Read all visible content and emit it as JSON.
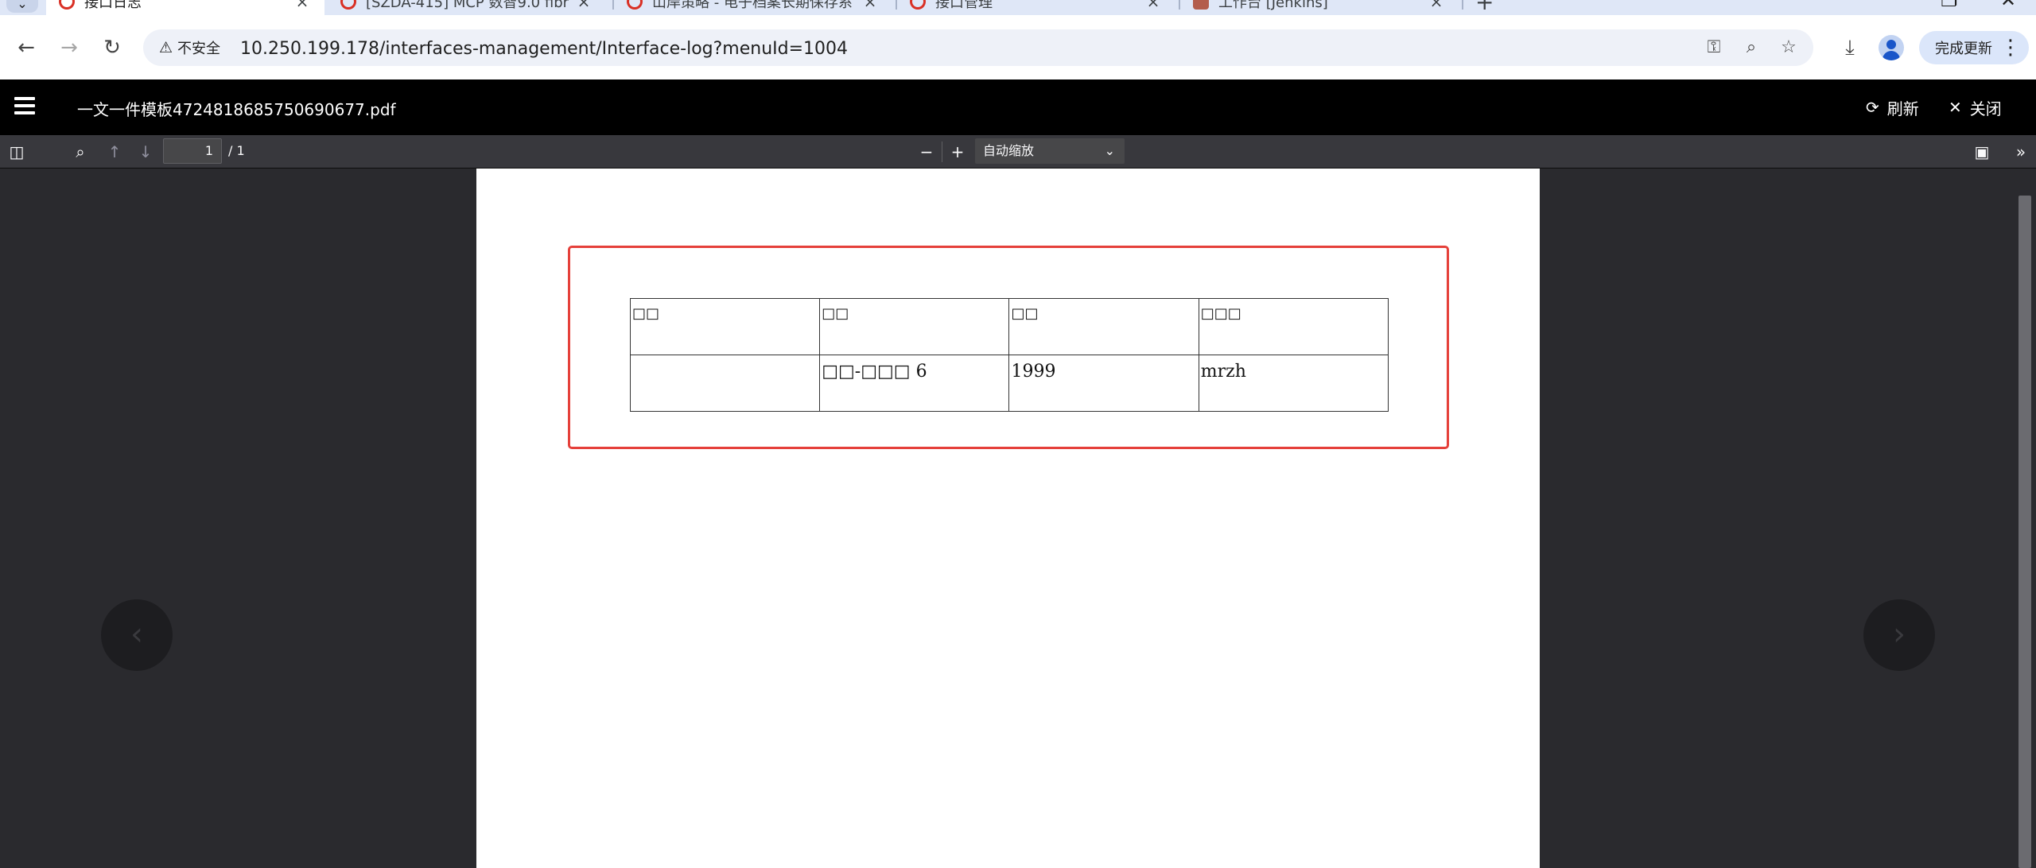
{
  "browser": {
    "tabs": [
      {
        "title": "接口日志",
        "active": true
      },
      {
        "title": "[SZDA-415] MCP 数智9.0 fibr",
        "active": false
      },
      {
        "title": "山岸策略 - 电子档案长期保存系",
        "active": false
      },
      {
        "title": "接口管理",
        "active": false
      },
      {
        "title": "工作台 [Jenkins]",
        "active": false
      }
    ],
    "security_label": "不安全",
    "url": "10.250.199.178/interfaces-management/Interface-log?menuId=1004",
    "update_label": "完成更新"
  },
  "app": {
    "doc_title": "一文一件模板4724818685750690677.pdf",
    "refresh_label": "刷新",
    "close_label": "关闭"
  },
  "pdf_toolbar": {
    "page_number": "1",
    "page_total": "/ 1",
    "zoom": "自动缩放"
  },
  "pdf_table": {
    "rows": [
      [
        "□□",
        "□□",
        "□□",
        "□□□"
      ],
      [
        "",
        "□□-□□□ 6",
        "1999",
        "mrzh"
      ]
    ]
  },
  "colors": {
    "highlight": "#e5403a",
    "header_bg": "#000000",
    "viewer_bg": "#2a2a2e"
  }
}
